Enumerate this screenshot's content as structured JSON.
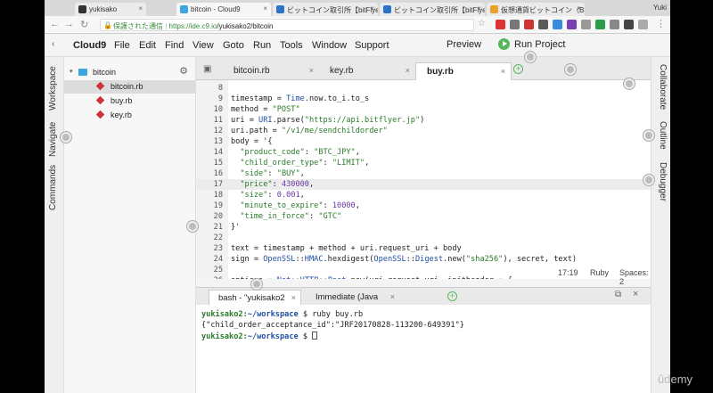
{
  "browser": {
    "tabs": [
      {
        "label": "yukisako",
        "active": false
      },
      {
        "label": "bitcoin - Cloud9",
        "active": true
      },
      {
        "label": "ビットコイン取引所【bitFlyer Lig",
        "active": false
      },
      {
        "label": "ビットコイン取引所【bitFlyer Lig",
        "active": false
      },
      {
        "label": "仮想通貨ビットコイン（Bitcoin）",
        "active": false
      }
    ],
    "user": "Yuki",
    "secure_label": "保護された通信",
    "url_host": "https://ide.c9.io",
    "url_path": "/yukisako2/bitcoin"
  },
  "menubar": {
    "items": [
      "Cloud9",
      "File",
      "Edit",
      "Find",
      "View",
      "Goto",
      "Run",
      "Tools",
      "Window",
      "Support"
    ],
    "preview": "Preview",
    "run_project": "Run Project"
  },
  "left_panels": [
    "Workspace",
    "Navigate",
    "Commands"
  ],
  "right_panels": [
    "Collaborate",
    "Outline",
    "Debugger"
  ],
  "tree": {
    "root": "bitcoin",
    "files": [
      "bitcoin.rb",
      "buy.rb",
      "key.rb"
    ]
  },
  "editor_tabs": [
    "bitcoin.rb",
    "key.rb",
    "buy.rb"
  ],
  "code_lines": [
    {
      "n": "8",
      "t": ""
    },
    {
      "n": "9",
      "t": "timestamp = Time.now.to_i.to_s"
    },
    {
      "n": "10",
      "t": "method = \"POST\""
    },
    {
      "n": "11",
      "t": "uri = URI.parse(\"https://api.bitflyer.jp\")"
    },
    {
      "n": "12",
      "t": "uri.path = \"/v1/me/sendchildorder\""
    },
    {
      "n": "13",
      "t": "body = '{"
    },
    {
      "n": "14",
      "t": "  \"product_code\": \"BTC_JPY\","
    },
    {
      "n": "15",
      "t": "  \"child_order_type\": \"LIMIT\","
    },
    {
      "n": "16",
      "t": "  \"side\": \"BUY\","
    },
    {
      "n": "17",
      "t": "  \"price\": 430000,"
    },
    {
      "n": "18",
      "t": "  \"size\": 0.001,"
    },
    {
      "n": "19",
      "t": "  \"minute_to_expire\": 10000,"
    },
    {
      "n": "20",
      "t": "  \"time_in_force\": \"GTC\""
    },
    {
      "n": "21",
      "t": "}'"
    },
    {
      "n": "22",
      "t": ""
    },
    {
      "n": "23",
      "t": "text = timestamp + method + uri.request_uri + body"
    },
    {
      "n": "24",
      "t": "sign = OpenSSL::HMAC.hexdigest(OpenSSL::Digest.new(\"sha256\"), secret, text)"
    },
    {
      "n": "25",
      "t": ""
    },
    {
      "n": "26",
      "t": "options = Net::HTTP::Post.new(uri.request_uri, initheader = {"
    }
  ],
  "status": {
    "position": "17:19",
    "language": "Ruby",
    "spaces": "Spaces: 2"
  },
  "terminal": {
    "tabs": [
      "bash - \"yukisako2",
      "Immediate (Java"
    ],
    "user": "yukisako2",
    "cwd": "~/workspace",
    "command": "ruby buy.rb",
    "output": "{\"child_order_acceptance_id\":\"JRF20170828-113200-649391\"}"
  },
  "watermark": "ûdemy"
}
